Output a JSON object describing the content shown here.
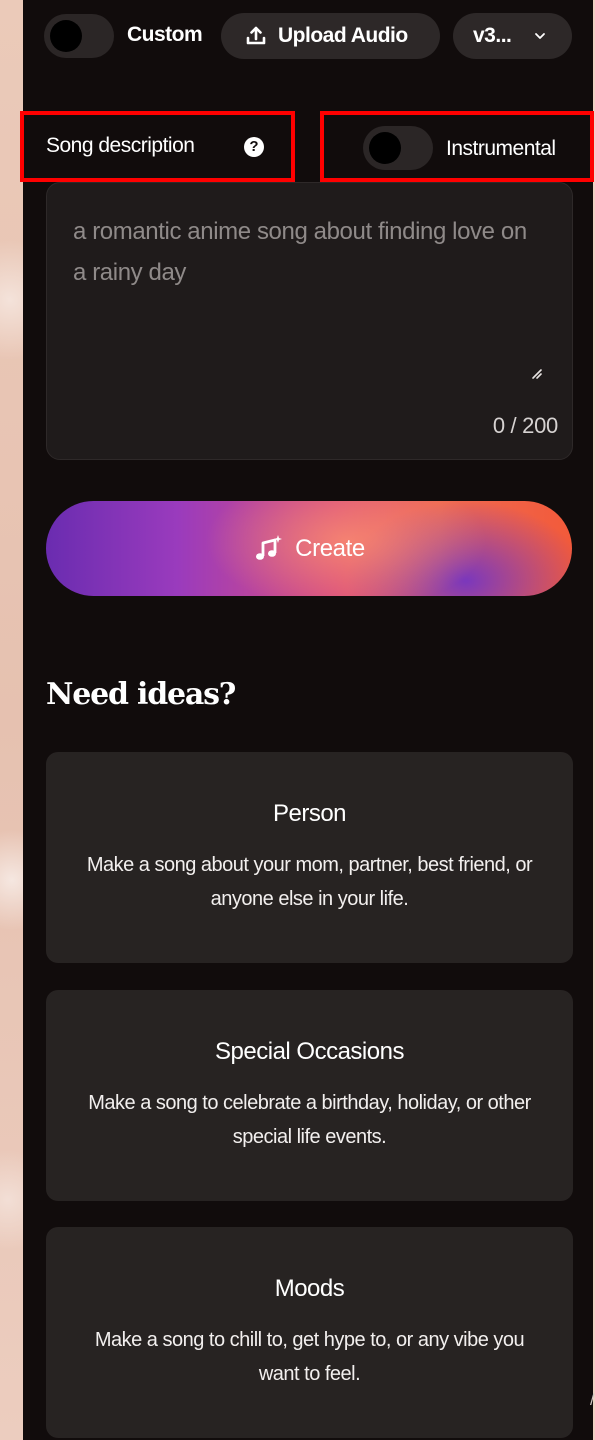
{
  "topbar": {
    "custom_label": "Custom",
    "upload_label": "Upload Audio",
    "version_label": "v3..."
  },
  "description": {
    "label": "Song description",
    "instrumental_label": "Instrumental",
    "placeholder": "a romantic anime song about finding love on a rainy day",
    "value": "",
    "counter": "0 / 200"
  },
  "create": {
    "label": "Create"
  },
  "ideas": {
    "title": "Need ideas?",
    "cards": [
      {
        "title": "Person",
        "desc": "Make a song about your mom, partner, best friend, or anyone else in your life."
      },
      {
        "title": "Special Occasions",
        "desc": "Make a song to celebrate a birthday, holiday, or other special life events."
      },
      {
        "title": "Moods",
        "desc": "Make a song to chill to, get hype to, or any vibe you want to feel."
      }
    ]
  },
  "colors": {
    "panel_bg": "#110c0c",
    "highlight": "#ff0000",
    "card_bg": "#272322",
    "create_gradient_start": "#6a2cb0",
    "create_gradient_end": "#f25a3a"
  },
  "icons": {
    "upload": "upload-icon",
    "dropdown": "chevron-down-icon",
    "help": "question-circle-icon",
    "create": "music-note-sparkle-icon"
  }
}
